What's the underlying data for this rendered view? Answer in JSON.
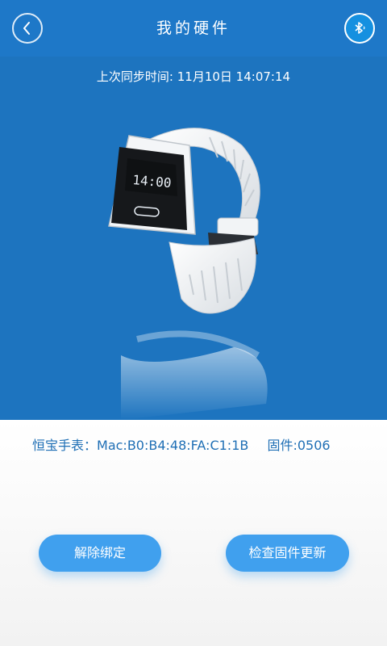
{
  "header": {
    "title": "我的硬件",
    "back_icon": "chevron-left-icon",
    "bluetooth_icon": "bluetooth-icon"
  },
  "sync": {
    "text": "上次同步时间: 11月10日 14:07:14"
  },
  "watch": {
    "screen_time": "14:00"
  },
  "device": {
    "name": "恒宝手表：",
    "mac": "Mac:B0:B4:48:FA:C1:1B",
    "firmware": "固件:0506"
  },
  "actions": {
    "unbind_label": "解除绑定",
    "update_label": "检查固件更新"
  },
  "colors": {
    "header": "#1e78c8",
    "hero": "#1d74bf",
    "accent": "#40a0ee",
    "device_text": "#1f6fb5"
  }
}
